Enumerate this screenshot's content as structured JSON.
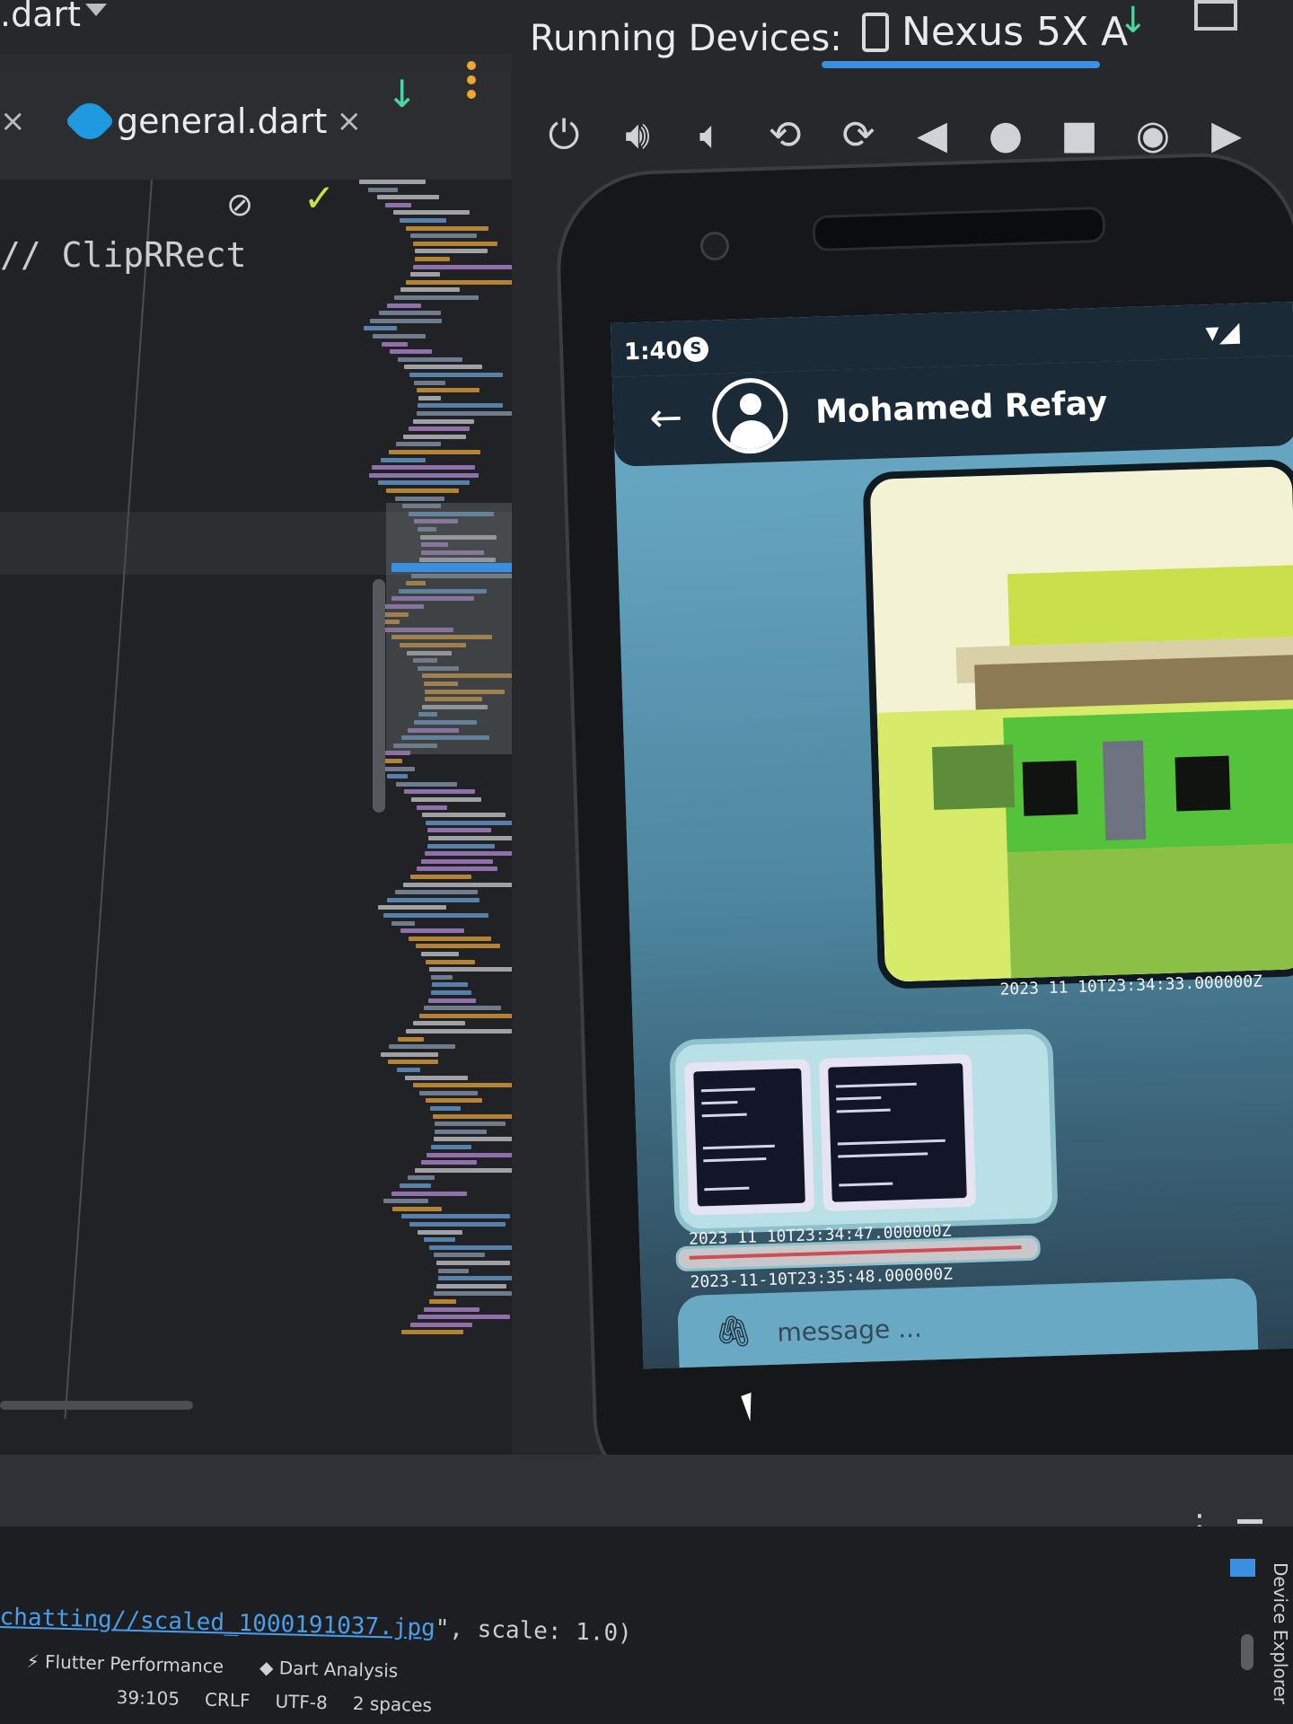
{
  "ide": {
    "file_title": ".dart",
    "tab_general": "general.dart",
    "tab_close": "×",
    "code_comment": "// ClipRRect"
  },
  "running_devices": {
    "header": "Running Devices:",
    "device_tab": "Nexus 5X A"
  },
  "phone": {
    "status_time": "1:40",
    "status_badge": "S",
    "contact_name": "Mohamed Refay",
    "messages": [
      {
        "type": "image",
        "timestamp": "2023 11 10T23:34:33.000000Z"
      },
      {
        "type": "images",
        "timestamp": "2023 11 10T23:34:47.000000Z"
      },
      {
        "type": "text",
        "timestamp": "2023-11-10T23:35:48.000000Z"
      }
    ],
    "input_placeholder": "message ..."
  },
  "console": {
    "link_text": "chatting//scaled_1000191037.jpg",
    "rest_text": "\", scale: 1.0)"
  },
  "status_bar": {
    "tools": [
      "Flutter Performance",
      "Dart Analysis"
    ],
    "position": "39:105",
    "line_ending": "CRLF",
    "encoding": "UTF-8",
    "indent": "2 spaces"
  },
  "side_panel_label": "Device Explorer",
  "colors": {
    "accent_blue": "#3b8fe0",
    "green_icon": "#4fd3a0",
    "appbar": "#1a2a36"
  }
}
